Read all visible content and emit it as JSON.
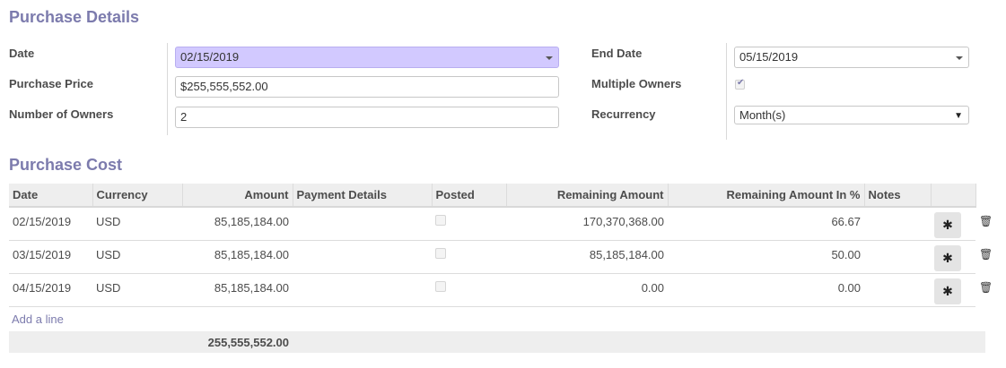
{
  "sections": {
    "purchase_details": "Purchase Details",
    "purchase_cost": "Purchase Cost"
  },
  "form": {
    "date_label": "Date",
    "date_value": "02/15/2019",
    "purchase_price_label": "Purchase Price",
    "purchase_price_value": "$255,555,552.00",
    "owners_label": "Number of Owners",
    "owners_value": "2",
    "end_date_label": "End Date",
    "end_date_value": "05/15/2019",
    "multiple_owners_label": "Multiple Owners",
    "multiple_owners_checked": true,
    "recurrency_label": "Recurrency",
    "recurrency_value": "Month(s)"
  },
  "table": {
    "headers": [
      "Date",
      "Currency",
      "Amount",
      "Payment Details",
      "Posted",
      "Remaining Amount",
      "Remaining Amount In %",
      "Notes"
    ],
    "rows": [
      {
        "date": "02/15/2019",
        "currency": "USD",
        "amount": "85,185,184.00",
        "payment_details": "",
        "posted": false,
        "remaining": "170,370,368.00",
        "remaining_pct": "66.67",
        "notes": ""
      },
      {
        "date": "03/15/2019",
        "currency": "USD",
        "amount": "85,185,184.00",
        "payment_details": "",
        "posted": false,
        "remaining": "85,185,184.00",
        "remaining_pct": "50.00",
        "notes": ""
      },
      {
        "date": "04/15/2019",
        "currency": "USD",
        "amount": "85,185,184.00",
        "payment_details": "",
        "posted": false,
        "remaining": "0.00",
        "remaining_pct": "0.00",
        "notes": ""
      }
    ],
    "add_line": "Add a line",
    "total_amount": "255,555,552.00"
  },
  "icons": {
    "gear": "gear-icon",
    "trash": "trash-icon",
    "caret": "caret-down-icon"
  },
  "colors": {
    "accent": "#7c7bad",
    "highlight": "#d2c9ff"
  }
}
